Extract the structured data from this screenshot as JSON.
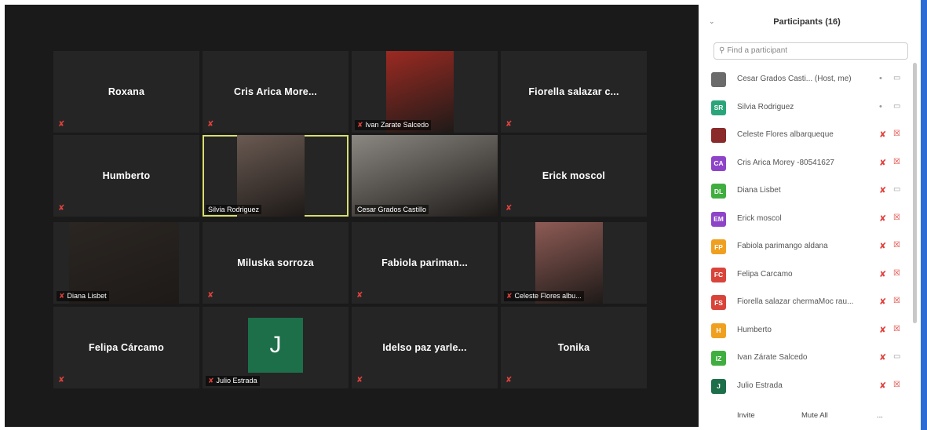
{
  "grid": [
    {
      "name": "Roxana",
      "type": "name",
      "muted": true
    },
    {
      "name": "Cris Arica More...",
      "type": "name",
      "muted": true
    },
    {
      "name": "Ivan Zarate Salcedo",
      "type": "video",
      "muted": true,
      "bg": "#9b2a22"
    },
    {
      "name": "Fiorella salazar c...",
      "type": "name",
      "muted": true
    },
    {
      "name": "Humberto",
      "type": "name",
      "muted": true
    },
    {
      "name": "Silvia Rodriguez",
      "type": "video",
      "muted": false,
      "active": true,
      "bg": "#6a5a52"
    },
    {
      "name": "Cesar Grados Castillo",
      "type": "video",
      "muted": false,
      "bg": "#8b8882"
    },
    {
      "name": "Erick moscol",
      "type": "name",
      "muted": true
    },
    {
      "name": "Diana Lisbet",
      "type": "video",
      "muted": true,
      "bg": "#2b2622"
    },
    {
      "name": "Miluska sorroza",
      "type": "name",
      "muted": true
    },
    {
      "name": "Fabiola pariman...",
      "type": "name",
      "muted": true
    },
    {
      "name": "Celeste Flores albu...",
      "type": "video",
      "muted": true,
      "bg": "#8e5b55"
    },
    {
      "name": "Felipa Cárcamo",
      "type": "name",
      "muted": true
    },
    {
      "name": "Julio Estrada",
      "type": "avatar",
      "initial": "J",
      "muted": true
    },
    {
      "name": "Idelso paz yarle...",
      "type": "name",
      "muted": true
    },
    {
      "name": "Tonika",
      "type": "name",
      "muted": true
    }
  ],
  "panel": {
    "title": "Participants (16)",
    "search_placeholder": "Find a participant",
    "participants": [
      {
        "initials": "",
        "name": "Cesar Grados Casti... (Host, me)",
        "color": "#6b6b6b",
        "mic": "on",
        "cam": "on"
      },
      {
        "initials": "SR",
        "name": "Silvia Rodriguez",
        "color": "#2aa57a",
        "mic": "on",
        "cam": "on"
      },
      {
        "initials": "",
        "name": "Celeste Flores albarqueque",
        "color": "#8a2a2a",
        "mic": "muted",
        "cam": "off"
      },
      {
        "initials": "CA",
        "name": "Cris Arica Morey -80541627",
        "color": "#8e44c8",
        "mic": "muted",
        "cam": "off"
      },
      {
        "initials": "DL",
        "name": "Diana Lisbet",
        "color": "#3fae3f",
        "mic": "muted",
        "cam": "on"
      },
      {
        "initials": "EM",
        "name": "Erick moscol",
        "color": "#8e44c8",
        "mic": "muted",
        "cam": "off"
      },
      {
        "initials": "FP",
        "name": "Fabiola parimango aldana",
        "color": "#f0a020",
        "mic": "muted",
        "cam": "off"
      },
      {
        "initials": "FC",
        "name": "Felipa Carcamo",
        "color": "#d9443a",
        "mic": "muted",
        "cam": "off"
      },
      {
        "initials": "FS",
        "name": "Fiorella salazar chermaMoc rau...",
        "color": "#d9443a",
        "mic": "muted",
        "cam": "off"
      },
      {
        "initials": "H",
        "name": "Humberto",
        "color": "#f0a020",
        "mic": "muted",
        "cam": "off"
      },
      {
        "initials": "IZ",
        "name": "Ivan Zárate Salcedo",
        "color": "#3fae3f",
        "mic": "muted",
        "cam": "on"
      },
      {
        "initials": "J",
        "name": "Julio Estrada",
        "color": "#1d6f4a",
        "mic": "muted",
        "cam": "off"
      }
    ],
    "footer": {
      "invite": "Invite",
      "mute_all": "Mute All",
      "more": "..."
    }
  },
  "icons": {
    "mic_muted": "🎙",
    "mic_on": "🎙",
    "cam_off": "⌧",
    "cam_on": "▭",
    "search": "🔍"
  }
}
